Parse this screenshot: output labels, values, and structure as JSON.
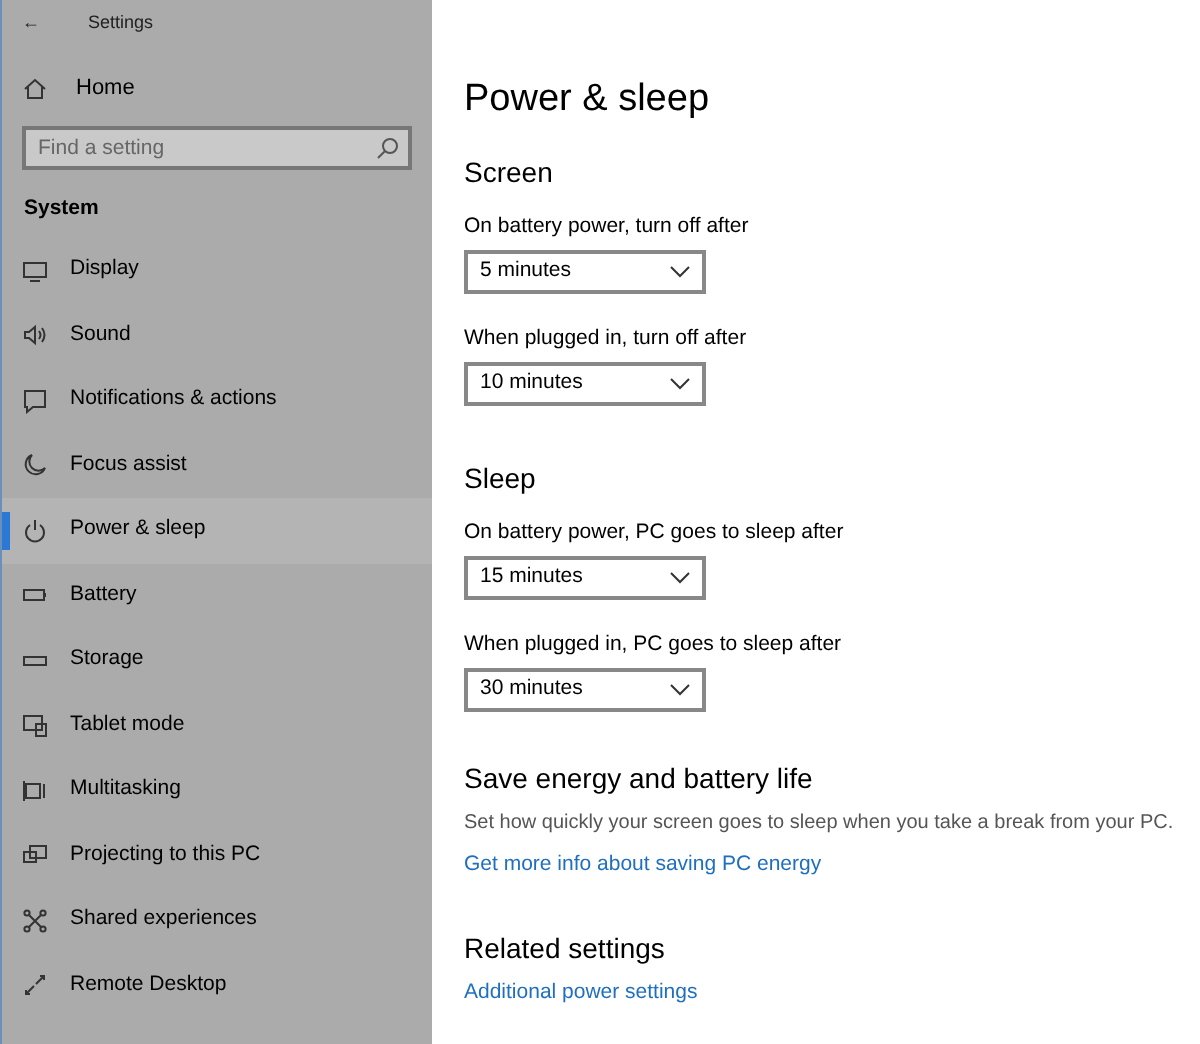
{
  "window": {
    "title": "Settings",
    "back": "←"
  },
  "sidebar": {
    "home": "Home",
    "search": {
      "placeholder": "Find a setting"
    },
    "section": "System",
    "items": [
      {
        "label": "Display",
        "selected": false
      },
      {
        "label": "Sound",
        "selected": false
      },
      {
        "label": "Notifications & actions",
        "selected": false
      },
      {
        "label": "Focus assist",
        "selected": false
      },
      {
        "label": "Power & sleep",
        "selected": true
      },
      {
        "label": "Battery",
        "selected": false
      },
      {
        "label": "Storage",
        "selected": false
      },
      {
        "label": "Tablet mode",
        "selected": false
      },
      {
        "label": "Multitasking",
        "selected": false
      },
      {
        "label": "Projecting to this PC",
        "selected": false
      },
      {
        "label": "Shared experiences",
        "selected": false
      },
      {
        "label": "Remote Desktop",
        "selected": false
      }
    ]
  },
  "page": {
    "title": "Power & sleep",
    "sections": [
      {
        "heading": "Screen",
        "settings": [
          {
            "label": "On battery power, turn off after",
            "value": "5 minutes"
          },
          {
            "label": "When plugged in, turn off after",
            "value": "10 minutes"
          }
        ]
      },
      {
        "heading": "Sleep",
        "settings": [
          {
            "label": "On battery power, PC goes to sleep after",
            "value": "15 minutes"
          },
          {
            "label": "When plugged in, PC goes to sleep after",
            "value": "30 minutes"
          }
        ]
      }
    ],
    "energy": {
      "heading": "Save energy and battery life",
      "description": "Set how quickly your screen goes to sleep when you take a break from your PC.",
      "link": "Get more info about saving PC energy"
    },
    "related": {
      "heading": "Related settings",
      "link": "Additional power settings"
    }
  }
}
